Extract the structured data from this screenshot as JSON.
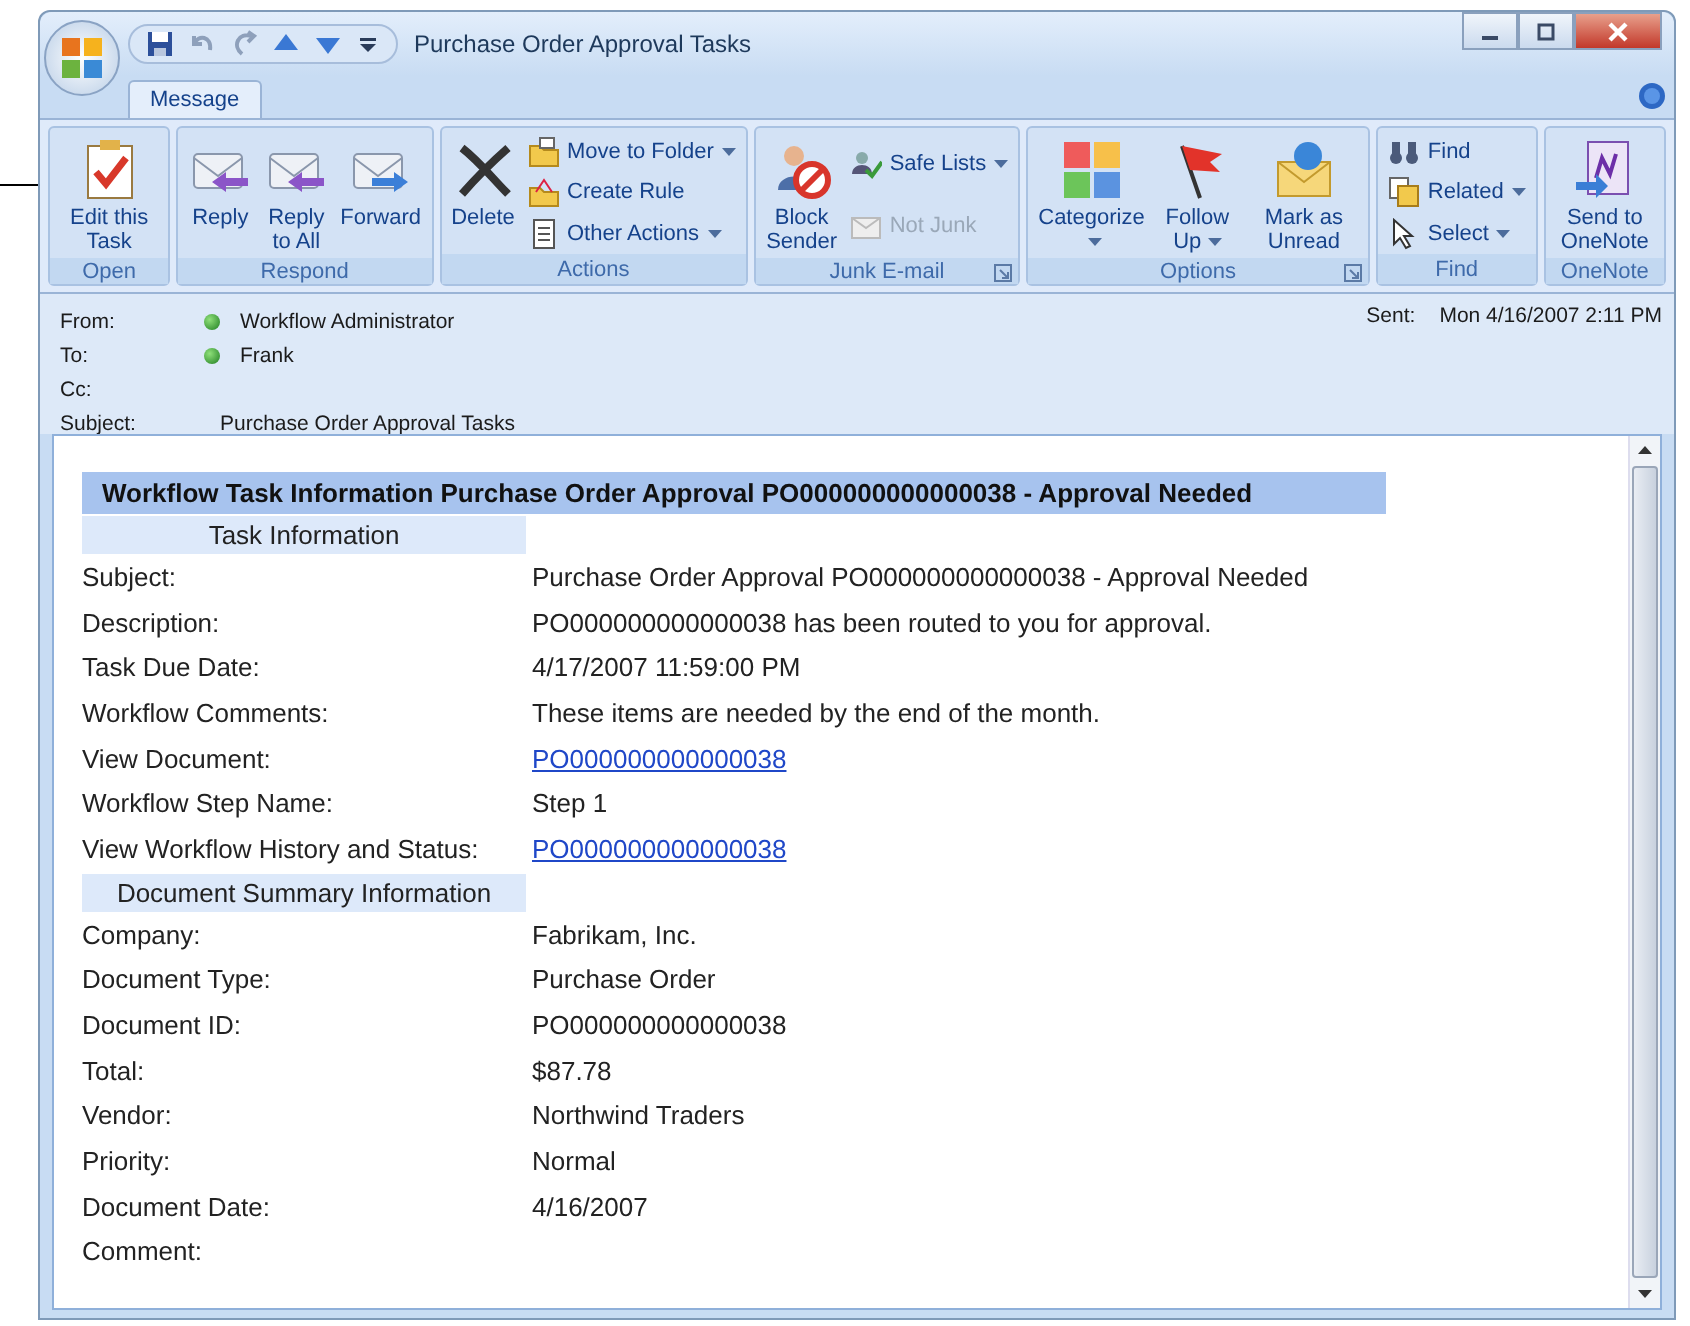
{
  "window": {
    "title": "Purchase Order Approval Tasks"
  },
  "tabs": [
    {
      "label": "Message",
      "selected": true
    }
  ],
  "ribbon": {
    "groups": [
      {
        "label": "Open",
        "launcher": false,
        "items": [
          {
            "kind": "large",
            "label": "Edit this Task",
            "dropdown": false,
            "disabled": false
          }
        ]
      },
      {
        "label": "Respond",
        "launcher": false,
        "items": [
          {
            "kind": "large",
            "label": "Reply",
            "dropdown": false,
            "disabled": false
          },
          {
            "kind": "large",
            "label": "Reply to All",
            "dropdown": false,
            "disabled": false
          },
          {
            "kind": "large",
            "label": "Forward",
            "dropdown": false,
            "disabled": false
          }
        ]
      },
      {
        "label": "Actions",
        "launcher": false,
        "items": [
          {
            "kind": "large",
            "label": "Delete",
            "dropdown": false,
            "disabled": false
          },
          {
            "kind": "small",
            "label": "Move to Folder",
            "dropdown": true,
            "disabled": false
          },
          {
            "kind": "small",
            "label": "Create Rule",
            "dropdown": false,
            "disabled": false
          },
          {
            "kind": "small",
            "label": "Other Actions",
            "dropdown": true,
            "disabled": false
          }
        ]
      },
      {
        "label": "Junk E-mail",
        "launcher": true,
        "items": [
          {
            "kind": "large",
            "label": "Block Sender",
            "dropdown": false,
            "disabled": false
          },
          {
            "kind": "small",
            "label": "Safe Lists",
            "dropdown": true,
            "disabled": false
          },
          {
            "kind": "small",
            "label": "Not Junk",
            "dropdown": false,
            "disabled": true
          }
        ]
      },
      {
        "label": "Options",
        "launcher": true,
        "items": [
          {
            "kind": "large",
            "label": "Categorize",
            "dropdown": true,
            "disabled": false
          },
          {
            "kind": "large",
            "label": "Follow Up",
            "dropdown": true,
            "disabled": false
          },
          {
            "kind": "large",
            "label": "Mark as Unread",
            "dropdown": false,
            "disabled": false
          }
        ]
      },
      {
        "label": "Find",
        "launcher": false,
        "items": [
          {
            "kind": "small",
            "label": "Find",
            "dropdown": false,
            "disabled": false
          },
          {
            "kind": "small",
            "label": "Related",
            "dropdown": true,
            "disabled": false
          },
          {
            "kind": "small",
            "label": "Select",
            "dropdown": true,
            "disabled": false
          }
        ]
      },
      {
        "label": "OneNote",
        "launcher": false,
        "items": [
          {
            "kind": "large",
            "label": "Send to OneNote",
            "dropdown": false,
            "disabled": false
          }
        ]
      }
    ]
  },
  "header": {
    "fields": [
      {
        "label": "From:",
        "value": "Workflow Administrator",
        "presence": true
      },
      {
        "label": "To:",
        "value": "Frank",
        "presence": true
      },
      {
        "label": "Cc:",
        "presence": false
      },
      {
        "label": "Subject:",
        "value": "Purchase Order Approval Tasks",
        "presence": false
      }
    ],
    "sent": {
      "label": "Sent:",
      "value": "Mon 4/16/2007 2:11 PM"
    }
  },
  "body": {
    "title": "Workflow Task Information Purchase Order Approval PO000000000000038 - Approval Needed",
    "rows": [
      {
        "kind": "section",
        "label": "Task Information"
      },
      {
        "kind": "field",
        "label": "Subject:",
        "value": "Purchase Order Approval PO000000000000038 - Approval Needed",
        "link": false
      },
      {
        "kind": "field",
        "label": "Description:",
        "value": "PO000000000000038 has been routed to you for approval.",
        "link": false
      },
      {
        "kind": "field",
        "label": "Task Due Date:",
        "value": "4/17/2007 11:59:00 PM",
        "link": false
      },
      {
        "kind": "field",
        "label": "Workflow Comments:",
        "value": "These items are needed by the end of the month.",
        "link": false
      },
      {
        "kind": "field",
        "label": "View Document:",
        "value": "PO000000000000038",
        "link": true
      },
      {
        "kind": "field",
        "label": "Workflow Step Name:",
        "value": "Step 1",
        "link": false
      },
      {
        "kind": "field",
        "label": "View Workflow History and Status:",
        "value": "PO000000000000038",
        "link": true
      },
      {
        "kind": "section",
        "label": "Document Summary Information"
      },
      {
        "kind": "field",
        "label": "Company:",
        "value": "Fabrikam, Inc.",
        "link": false
      },
      {
        "kind": "field",
        "label": "Document Type:",
        "value": "Purchase Order",
        "link": false
      },
      {
        "kind": "field",
        "label": "Document ID:",
        "value": "PO000000000000038",
        "link": false
      },
      {
        "kind": "field",
        "label": "Total:",
        "value": "$87.78",
        "link": false
      },
      {
        "kind": "field",
        "label": "Vendor:",
        "value": "Northwind Traders",
        "link": false
      },
      {
        "kind": "field",
        "label": "Priority:",
        "value": "Normal",
        "link": false
      },
      {
        "kind": "field",
        "label": "Document Date:",
        "value": "4/16/2007",
        "link": false
      },
      {
        "kind": "field",
        "label": "Comment:"
      }
    ]
  }
}
